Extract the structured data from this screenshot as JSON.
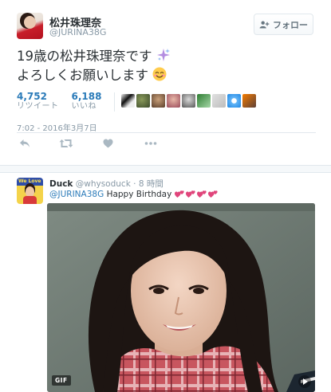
{
  "tweet": {
    "display_name": "松井珠理奈",
    "handle": "@JURINA38G",
    "follow_label": "フォロー",
    "text_line1": "19歳の松井珠理奈です",
    "text_line2": "よろしくお願いします",
    "retweets": {
      "count": "4,752",
      "label": "リツイート"
    },
    "likes": {
      "count": "6,188",
      "label": "いいね"
    },
    "likers_count": 9,
    "timestamp": "7:02 - 2016年3月7日",
    "actions": [
      "reply-icon",
      "retweet-icon",
      "like-icon",
      "more-icon"
    ]
  },
  "reply": {
    "display_name": "Duck",
    "handle": "@whysoduck",
    "separator": "·",
    "age": "8 時間",
    "mention": "@JURINA38G",
    "text": "Happy Birthday",
    "media_badge": "GIF",
    "media_icons": [
      "hearts-emoji",
      "play-icon"
    ]
  },
  "colors": {
    "link": "#2b7bb9",
    "secondary": "#8899a6",
    "text": "#292f33",
    "border": "#e1e8ed"
  }
}
